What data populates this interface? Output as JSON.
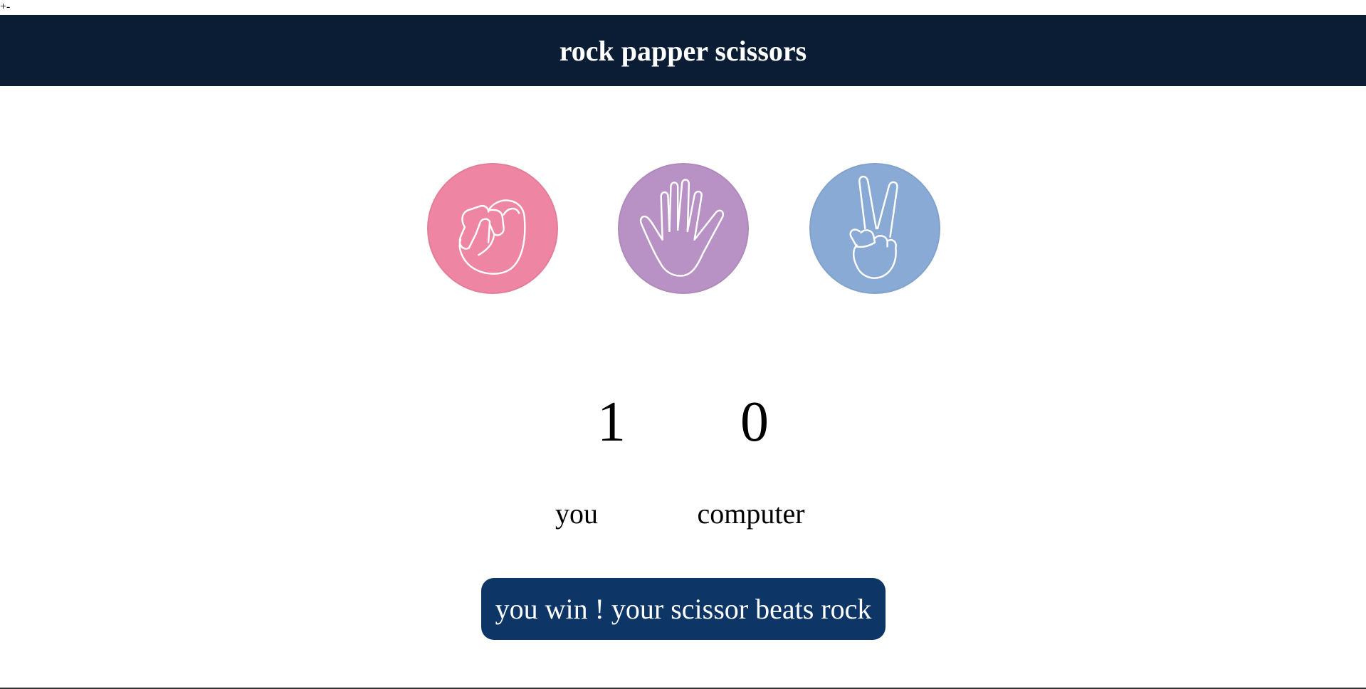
{
  "corner": "+-",
  "header": {
    "title": "rock papper scissors"
  },
  "choices": [
    {
      "id": "rock",
      "icon": "fist-icon",
      "color": "#ee85a2"
    },
    {
      "id": "paper",
      "icon": "open-hand-icon",
      "color": "#b892c4"
    },
    {
      "id": "scissors",
      "icon": "peace-hand-icon",
      "color": "#8aaad6"
    }
  ],
  "score": {
    "user": "1",
    "computer": "0",
    "user_label": "you",
    "computer_label": "computer"
  },
  "message": "you win ! your scissor beats rock",
  "colors": {
    "header_bg": "#0b1d34",
    "message_bg": "#0d3667"
  }
}
